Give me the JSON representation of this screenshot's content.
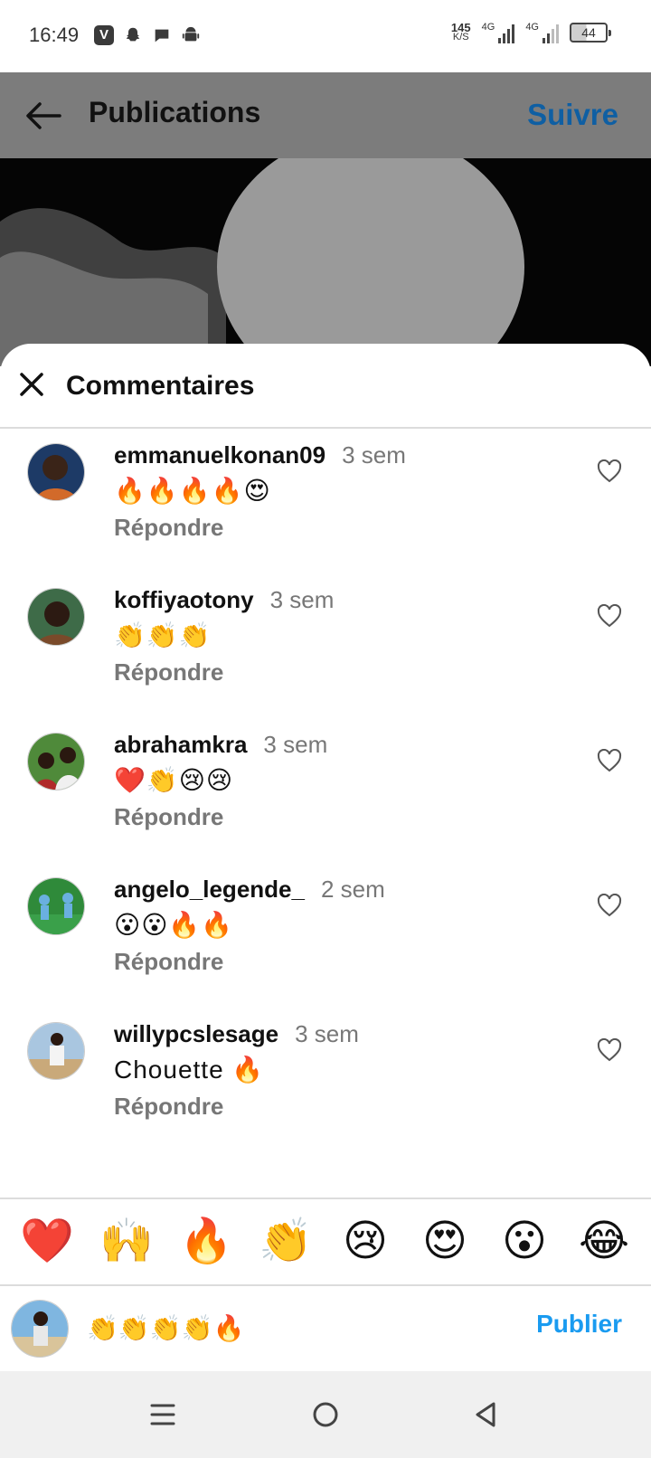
{
  "status_bar": {
    "time": "16:49",
    "app_icons": [
      "vimeo-icon",
      "snapchat-icon",
      "chat-icon",
      "android-icon"
    ],
    "v_label": "V",
    "speed_value": "145",
    "speed_unit": "K/S",
    "network_1": "4G",
    "network_2": "4G",
    "battery": "44"
  },
  "header": {
    "title": "Publications",
    "follow_label": "Suivre"
  },
  "sheet": {
    "title": "Commentaires",
    "reply_label": "Répondre",
    "comments": [
      {
        "username": "emmanuelkonan09",
        "time": "3 sem",
        "text": "🔥🔥🔥🔥😍"
      },
      {
        "username": "koffiyaotony",
        "time": "3 sem",
        "text": "👏👏👏"
      },
      {
        "username": "abrahamkra",
        "time": "3 sem",
        "text": "❤️👏😢😢"
      },
      {
        "username": "angelo_legende_",
        "time": "2 sem",
        "text": "😮😮🔥🔥"
      },
      {
        "username": "willypcslesage",
        "time": "3 sem",
        "text": "Chouette 🔥"
      }
    ]
  },
  "emoji_bar": [
    "❤️",
    "🙌",
    "🔥",
    "👏",
    "😢",
    "😍",
    "😮",
    "😂"
  ],
  "composer": {
    "value": "👏👏👏👏🔥",
    "publish_label": "Publier"
  },
  "colors": {
    "follow": "#0f5fa3",
    "publish": "#1a9bf0",
    "header_overlay": "#7c7c7c"
  }
}
